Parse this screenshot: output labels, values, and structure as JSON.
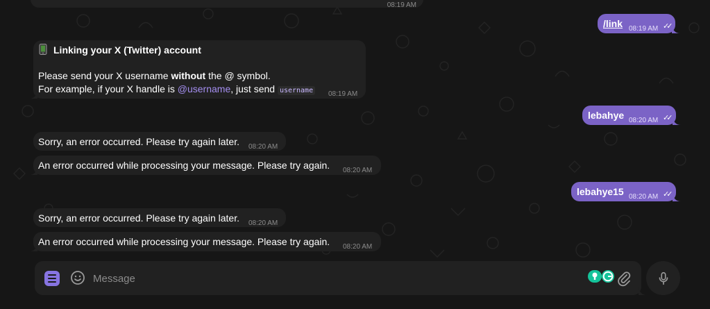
{
  "messages": [
    {
      "id": "top_partial",
      "direction": "incoming",
      "time": "08:19 AM"
    },
    {
      "id": "link_cmd",
      "direction": "outgoing",
      "text": "/link",
      "time": "08:19 AM"
    },
    {
      "id": "instructions",
      "direction": "incoming",
      "icon": "phone-icon",
      "title": "Linking your X (Twitter) account",
      "line1_pre": "Please send your X username ",
      "line1_bold": "without",
      "line1_post": " the @ symbol.",
      "line2_pre": "For example, if your X handle is ",
      "line2_link": "@username",
      "line2_mid": ", just send ",
      "line2_code": "username",
      "time": "08:19 AM"
    },
    {
      "id": "reply1",
      "direction": "outgoing",
      "text": "lebahye",
      "time": "08:20 AM"
    },
    {
      "id": "err1a",
      "direction": "incoming",
      "text": "Sorry, an error occurred. Please try again later.",
      "time": "08:20 AM"
    },
    {
      "id": "err1b",
      "direction": "incoming",
      "text": "An error occurred while processing your message. Please try again.",
      "time": "08:20 AM"
    },
    {
      "id": "reply2",
      "direction": "outgoing",
      "text": "lebahye15",
      "time": "08:20 AM"
    },
    {
      "id": "err2a",
      "direction": "incoming",
      "text": "Sorry, an error occurred. Please try again later.",
      "time": "08:20 AM"
    },
    {
      "id": "err2b",
      "direction": "incoming",
      "text": "An error occurred while processing your message. Please try again.",
      "time": "08:20 AM"
    }
  ],
  "composer": {
    "placeholder": "Message",
    "value": ""
  },
  "icons": {
    "menu": "bot-menu-icon",
    "emoji": "emoji-icon",
    "grammarly": "grammarly-icon",
    "attach": "paperclip-icon",
    "mic": "microphone-icon",
    "read": "double-check-icon"
  },
  "colors": {
    "background": "#161616",
    "incoming_bubble": "#212121",
    "outgoing_bubble": "#7b63c6",
    "accent": "#8774e1",
    "link": "#a48ef0"
  }
}
